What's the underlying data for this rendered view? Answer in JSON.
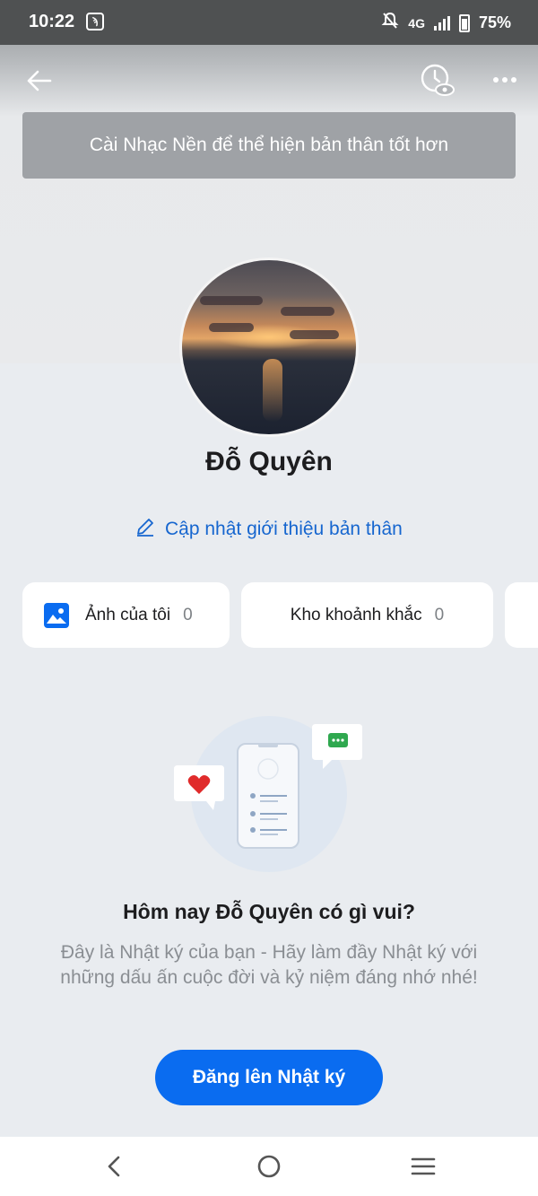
{
  "status_bar": {
    "time": "10:22",
    "network": "4G",
    "battery": "75%"
  },
  "header": {
    "music_banner": "Cài Nhạc Nền để thể hiện bản thân tốt hơn"
  },
  "profile": {
    "name": "Đỗ Quyên",
    "update_bio": "Cập nhật giới thiệu bản thân"
  },
  "cards": {
    "photos_label": "Ảnh của tôi",
    "photos_count": "0",
    "moments_label": "Kho khoảnh khắc",
    "moments_count": "0"
  },
  "diary": {
    "title": "Hôm nay Đỗ Quyên có gì vui?",
    "description": "Đây là Nhật ký của bạn - Hãy làm đầy Nhật ký với những dấu ấn cuộc đời và kỷ niệm đáng nhớ nhé!",
    "post_button": "Đăng lên Nhật ký"
  },
  "colors": {
    "accent": "#0a6cf0",
    "link": "#1666cf",
    "background": "#e9ecf0"
  }
}
